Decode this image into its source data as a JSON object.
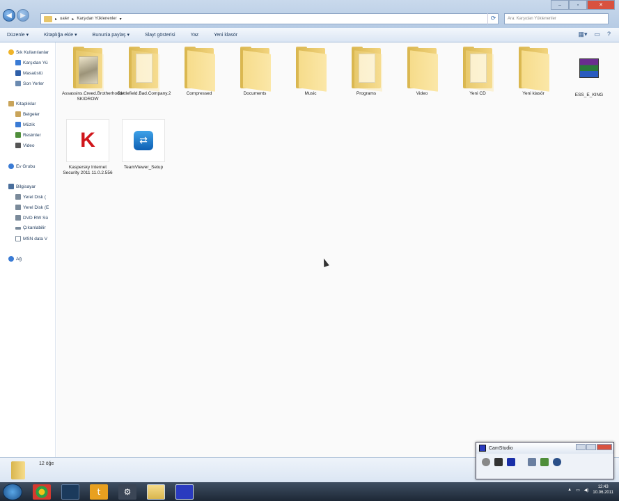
{
  "window": {
    "address_segments": [
      "ualer",
      "Karşıdan Yüklenenler"
    ],
    "search_placeholder": "Ara: Karşıdan Yüklenenler"
  },
  "toolbar": {
    "items": [
      "Düzenle ▾",
      "Kitaplığa ekle ▾",
      "Bununla paylaş ▾",
      "Slayt gösterisi",
      "Yaz",
      "Yeni klasör"
    ]
  },
  "sidebar": {
    "items": [
      {
        "label": "Sık Kullanılanlar",
        "icon": "star-icon",
        "color": "#f0b429"
      },
      {
        "label": "Karşıdan Yü",
        "icon": "download-icon",
        "color": "#3a7bd5"
      },
      {
        "label": "Masaüstü",
        "icon": "desktop-icon",
        "color": "#2f5fa8"
      },
      {
        "label": "Son Yerler",
        "icon": "recent-icon",
        "color": "#6b8ab0"
      },
      {
        "label": "Kitaplıklar",
        "icon": "library-icon",
        "color": "#c9a45a"
      },
      {
        "label": "Belgeler",
        "icon": "documents-icon",
        "color": "#c9a45a"
      },
      {
        "label": "Müzik",
        "icon": "music-icon",
        "color": "#3a7bd5"
      },
      {
        "label": "Resimler",
        "icon": "pictures-icon",
        "color": "#4f8e3a"
      },
      {
        "label": "Video",
        "icon": "video-icon",
        "color": "#555"
      },
      {
        "label": "Ev Grubu",
        "icon": "homegroup-icon",
        "color": "#3a7bd5"
      },
      {
        "label": "Bilgisayar",
        "icon": "computer-icon",
        "color": "#4a6f9c"
      },
      {
        "label": "Yerel Disk (",
        "icon": "disk-icon",
        "color": "#7a8a9a"
      },
      {
        "label": "Yerel Disk (E",
        "icon": "disk-icon",
        "color": "#7a8a9a"
      },
      {
        "label": "DVD RW Sü",
        "icon": "dvd-icon",
        "color": "#7a8a9a"
      },
      {
        "label": "Çıkarılabilir",
        "icon": "removable-icon",
        "color": "#7a8a9a"
      },
      {
        "label": "MSN data V",
        "icon": "drive-icon",
        "color": "#7a8a9a"
      },
      {
        "label": "Ağ",
        "icon": "network-icon",
        "color": "#3a7bd5"
      }
    ]
  },
  "files": [
    {
      "label": "Assassins.Creed.Brotherhood-SKIDROW",
      "kind": "folder-photo"
    },
    {
      "label": "Battlefield.Bad.Company.2",
      "kind": "folder-paper"
    },
    {
      "label": "Compressed",
      "kind": "folder"
    },
    {
      "label": "Documents",
      "kind": "folder"
    },
    {
      "label": "Music",
      "kind": "folder"
    },
    {
      "label": "Programs",
      "kind": "folder-paper"
    },
    {
      "label": "Video",
      "kind": "folder"
    },
    {
      "label": "Yeni CD",
      "kind": "folder-paper"
    },
    {
      "label": "Yeni klasör",
      "kind": "folder"
    },
    {
      "label": "ESS_E_KING",
      "kind": "archive"
    },
    {
      "label": "Kaspersky Internet Security 2011 11.0.2.556",
      "kind": "kaspersky"
    },
    {
      "label": "TeamViewer_Setup",
      "kind": "teamviewer"
    }
  ],
  "status": {
    "count": "12 öğe"
  },
  "camstudio": {
    "title": "CamStudio"
  },
  "clock": {
    "time": "12:43",
    "date": "10.06.2011"
  }
}
